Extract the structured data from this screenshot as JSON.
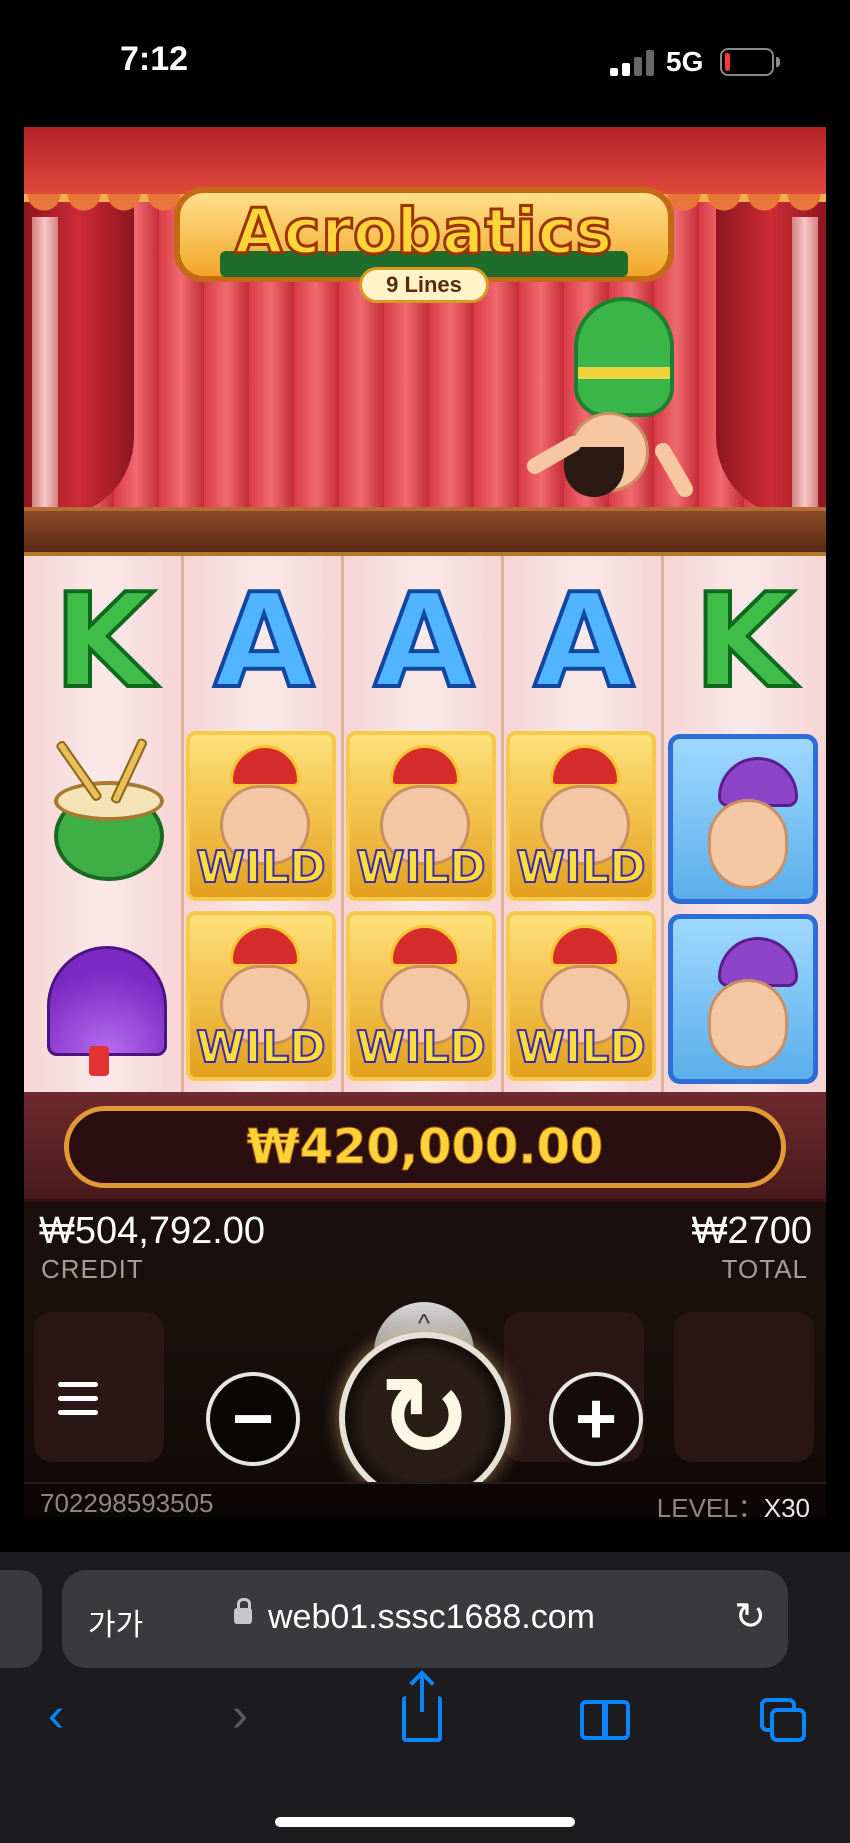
{
  "status_bar": {
    "time": "7:12",
    "network": "5G",
    "battery_level": 0.12,
    "battery_color": "#ff3b30"
  },
  "game": {
    "title": "Acrobatics",
    "lines_label": "9 Lines",
    "reels": [
      [
        "K",
        "drum",
        "fan"
      ],
      [
        "A",
        "WILD",
        "WILD"
      ],
      [
        "A",
        "WILD",
        "WILD"
      ],
      [
        "A",
        "WILD",
        "WILD"
      ],
      [
        "K",
        "blue-acrobat",
        "blue-acrobat"
      ]
    ],
    "wild_label": "WILD",
    "win_amount": "₩420,000.00",
    "credit_value": "₩504,792.00",
    "credit_label": "CREDIT",
    "total_value": "₩2700",
    "total_label": "TOTAL",
    "minus_label": "−",
    "plus_label": "+",
    "spin_chevron": "^",
    "spin_icon": "↻",
    "game_id": "702298593505",
    "level_label": "LEVEL：",
    "level_value": "X30",
    "colors": {
      "win_gold": "#ffd23a",
      "k_green": "#3fbd48",
      "a_blue": "#52b5ff"
    }
  },
  "browser": {
    "text_size_label": "가가",
    "url": "web01.sssc1688.com",
    "reload_icon": "↻",
    "back_icon": "‹",
    "forward_icon": "›",
    "icons": [
      "share-icon",
      "bookmarks-icon",
      "tabs-icon"
    ],
    "accent": "#0a84ff"
  }
}
